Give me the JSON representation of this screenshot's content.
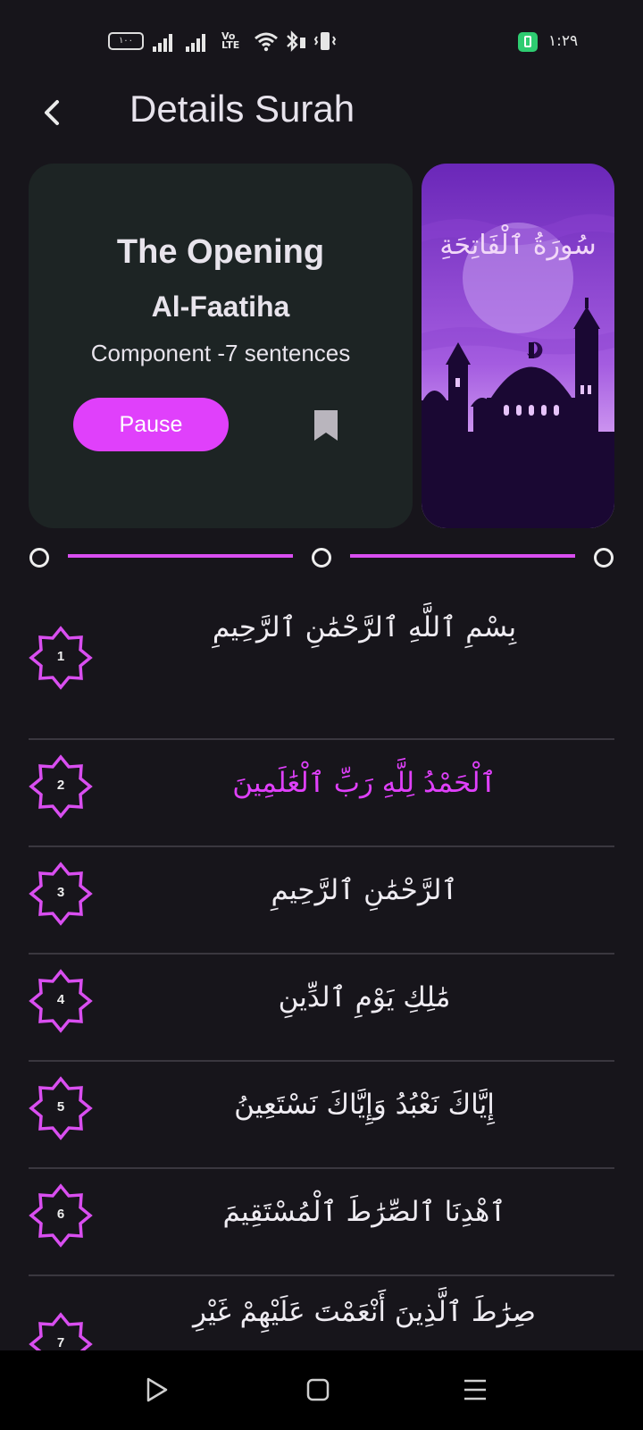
{
  "status_bar": {
    "battery_level": "١٠٠",
    "network_label": "Vo LTE",
    "time": "١:٢٩",
    "charge_color": "#2ecc71"
  },
  "header": {
    "title": "Details Surah"
  },
  "surah_card": {
    "title": "The Opening",
    "subtitle": "Al-Faatiha",
    "count_text": "Component -7 sentences",
    "pause_label": "Pause",
    "accent": "#e040fb"
  },
  "image_card": {
    "arabic_title": "سُورَةُ ٱلْفَاتِحَةِ"
  },
  "pager": {
    "pages": 3
  },
  "ayahs": [
    {
      "num": "1",
      "text": "بِسْمِ ٱللَّهِ ٱلرَّحْمَٰنِ ٱلرَّحِيمِ"
    },
    {
      "num": "2",
      "text": "ٱلْحَمْدُ لِلَّهِ رَبِّ ٱلْعَٰلَمِينَ"
    },
    {
      "num": "3",
      "text": "ٱلرَّحْمَٰنِ ٱلرَّحِيمِ"
    },
    {
      "num": "4",
      "text": "مَٰلِكِ يَوْمِ ٱلدِّينِ"
    },
    {
      "num": "5",
      "text": "إِيَّاكَ نَعْبُدُ وَإِيَّاكَ نَسْتَعِينُ"
    },
    {
      "num": "6",
      "text": "ٱهْدِنَا ٱلصِّرَٰطَ ٱلْمُسْتَقِيمَ"
    },
    {
      "num": "7",
      "text": "صِرَٰطَ ٱلَّذِينَ أَنْعَمْتَ عَلَيْهِمْ غَيْرِ"
    }
  ]
}
